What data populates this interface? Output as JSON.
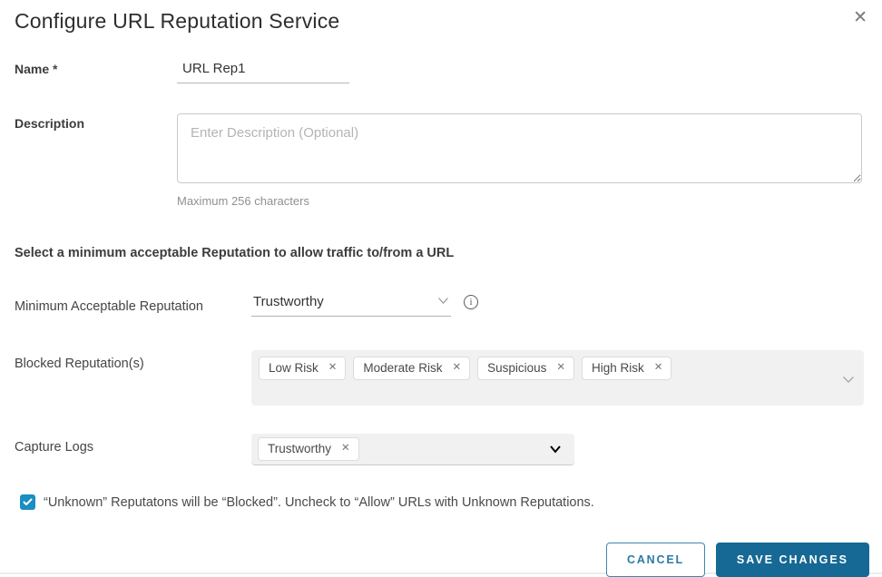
{
  "dialog": {
    "title": "Configure URL Reputation Service"
  },
  "icons": {
    "close": "✕",
    "chip_close": "✕",
    "info": "i"
  },
  "fields": {
    "name": {
      "label": "Name",
      "required_marker": "*",
      "value": "URL Rep1"
    },
    "description": {
      "label": "Description",
      "placeholder": "Enter Description (Optional)",
      "helper_text": "Maximum 256 characters"
    },
    "section_heading": "Select a minimum acceptable Reputation to allow traffic to/from a URL",
    "minimum_acceptable_reputation": {
      "label": "Minimum Acceptable Reputation",
      "selected_value": "Trustworthy"
    },
    "blocked_reputations": {
      "label": "Blocked Reputation(s)",
      "selected_chips": [
        "Low Risk",
        "Moderate Risk",
        "Suspicious",
        "High Risk"
      ]
    },
    "capture_logs": {
      "label": "Capture Logs",
      "selected_chips": [
        "Trustworthy"
      ]
    },
    "unknown_reputation_checkbox": {
      "checked": true,
      "label": "“Unknown” Reputatons will be “Blocked”. Uncheck to “Allow” URLs with Unknown Reputations."
    }
  },
  "footer": {
    "cancel_label": "CANCEL",
    "save_label": "SAVE CHANGES"
  },
  "colors": {
    "primary_button": "#166994",
    "cancel_button_border": "#3d87ab",
    "checkbox_checked": "#1b8ec2",
    "multiselect_background": "#f1f1f1",
    "chip_background": "#ffffff"
  }
}
